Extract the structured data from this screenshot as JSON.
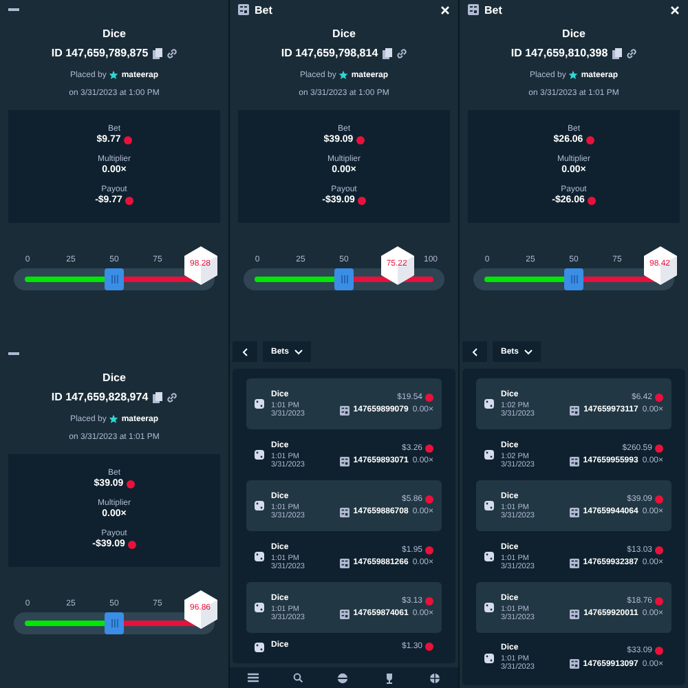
{
  "columns": [
    {
      "blocks": [
        {
          "kind": "bet-detail",
          "header": {
            "kind": "bar"
          },
          "game": "Dice",
          "id": "ID 147,659,789,875",
          "placed_label": "Placed by",
          "user": "mateerap",
          "date": "on 3/31/2023 at 1:00 PM",
          "bet_label": "Bet",
          "bet": "$9.77",
          "multiplier_label": "Multiplier",
          "multiplier": "0.00×",
          "payout_label": "Payout",
          "payout": "-$9.77",
          "slider": {
            "ticks": [
              "0",
              "25",
              "50",
              "75"
            ],
            "thumb": {
              "level": 0.5
            },
            "result": {
              "value": "98.28",
              "level": 0.9828
            }
          }
        },
        {
          "kind": "bet-detail",
          "header": {
            "kind": "bar"
          },
          "game": "Dice",
          "id": "ID 147,659,828,974",
          "placed_label": "Placed by",
          "user": "mateerap",
          "date": "on 3/31/2023 at 1:01 PM",
          "bet_label": "Bet",
          "bet": "$39.09",
          "multiplier_label": "Multiplier",
          "multiplier": "0.00×",
          "payout_label": "Payout",
          "payout": "-$39.09",
          "slider": {
            "ticks": [
              "0",
              "25",
              "50",
              "75"
            ],
            "thumb": {
              "level": 0.5
            },
            "result": {
              "value": "96.86",
              "level": 0.9686
            }
          }
        }
      ]
    },
    {
      "blocks": [
        {
          "kind": "bet-detail",
          "header": {
            "kind": "titled",
            "title": "Bet",
            "closable": true
          },
          "game": "Dice",
          "id": "ID 147,659,798,814",
          "placed_label": "Placed by",
          "user": "mateerap",
          "date": "on 3/31/2023 at 1:00 PM",
          "bet_label": "Bet",
          "bet": "$39.09",
          "multiplier_label": "Multiplier",
          "multiplier": "0.00×",
          "payout_label": "Payout",
          "payout": "-$39.09",
          "slider": {
            "ticks": [
              "0",
              "25",
              "50",
              "100"
            ],
            "thumb": {
              "level": 0.5
            },
            "result": {
              "value": "75.22",
              "level": 0.7522
            }
          }
        },
        {
          "kind": "bets-list",
          "dropdown": "Bets",
          "rows": [
            {
              "game": "Dice",
              "time": "1:01 PM",
              "date": "3/31/2023",
              "amount": "$19.54",
              "id": "147659899079",
              "multiplier": "0.00×"
            },
            {
              "game": "Dice",
              "time": "1:01 PM",
              "date": "3/31/2023",
              "amount": "$3.26",
              "id": "147659893071",
              "multiplier": "0.00×"
            },
            {
              "game": "Dice",
              "time": "1:01 PM",
              "date": "3/31/2023",
              "amount": "$5.86",
              "id": "147659886708",
              "multiplier": "0.00×"
            },
            {
              "game": "Dice",
              "time": "1:01 PM",
              "date": "3/31/2023",
              "amount": "$1.95",
              "id": "147659881266",
              "multiplier": "0.00×"
            },
            {
              "game": "Dice",
              "time": "1:01 PM",
              "date": "3/31/2023",
              "amount": "$3.13",
              "id": "147659874061",
              "multiplier": "0.00×"
            },
            {
              "game": "Dice",
              "amount": "$1.30"
            }
          ]
        },
        {
          "kind": "nav"
        }
      ]
    },
    {
      "blocks": [
        {
          "kind": "bet-detail",
          "header": {
            "kind": "titled",
            "title": "Bet",
            "closable": true
          },
          "game": "Dice",
          "id": "ID 147,659,810,398",
          "placed_label": "Placed by",
          "user": "mateerap",
          "date": "on 3/31/2023 at 1:01 PM",
          "bet_label": "Bet",
          "bet": "$26.06",
          "multiplier_label": "Multiplier",
          "multiplier": "0.00×",
          "payout_label": "Payout",
          "payout": "-$26.06",
          "slider": {
            "ticks": [
              "0",
              "25",
              "50",
              "75"
            ],
            "thumb": {
              "level": 0.5
            },
            "result": {
              "value": "98.42",
              "level": 0.9842
            }
          }
        },
        {
          "kind": "bets-list",
          "dropdown": "Bets",
          "rows": [
            {
              "game": "Dice",
              "time": "1:02 PM",
              "date": "3/31/2023",
              "amount": "$6.42",
              "id": "147659973117",
              "multiplier": "0.00×"
            },
            {
              "game": "Dice",
              "time": "1:02 PM",
              "date": "3/31/2023",
              "amount": "$260.59",
              "id": "147659955993",
              "multiplier": "0.00×"
            },
            {
              "game": "Dice",
              "time": "1:01 PM",
              "date": "3/31/2023",
              "amount": "$39.09",
              "id": "147659944064",
              "multiplier": "0.00×"
            },
            {
              "game": "Dice",
              "time": "1:01 PM",
              "date": "3/31/2023",
              "amount": "$13.03",
              "id": "147659932387",
              "multiplier": "0.00×"
            },
            {
              "game": "Dice",
              "time": "1:01 PM",
              "date": "3/31/2023",
              "amount": "$18.76",
              "id": "147659920011",
              "multiplier": "0.00×"
            },
            {
              "game": "Dice",
              "time": "1:01 PM",
              "date": "3/31/2023",
              "amount": "$33.09",
              "id": "147659913097",
              "multiplier": "0.00×"
            }
          ]
        }
      ]
    }
  ]
}
